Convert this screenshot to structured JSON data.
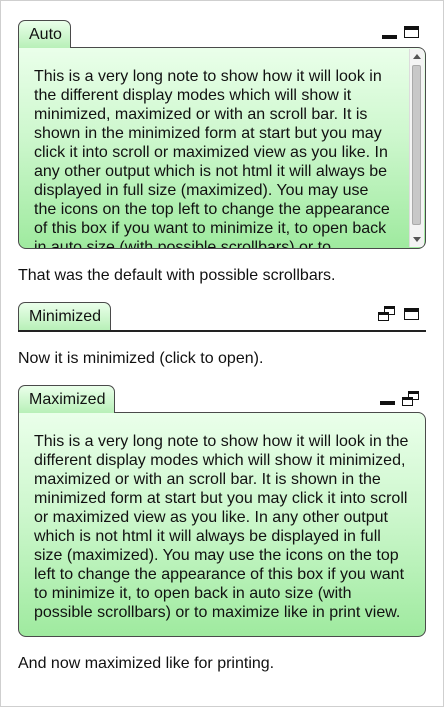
{
  "notes": [
    {
      "title": "Auto",
      "mode": "auto",
      "text": "This is a very long note to show how it will look in the different display modes which will show it minimized, maximized or with an scroll bar. It is shown in the minimized form at start but you may click it into scroll or maximized view as you like. In any other output which is not html it will always be displayed in full size (maximized). You may use the icons on the top left to change the appearance of this box if you want to minimize it, to open back in auto size (with possible scrollbars) or to maximize like in print view.",
      "controls": [
        "minimize-icon",
        "maximize-icon"
      ],
      "caption": "That was the default with possible scrollbars."
    },
    {
      "title": "Minimized",
      "mode": "minimized",
      "controls": [
        "restore-icon",
        "maximize-icon"
      ],
      "caption": "Now it is minimized (click to open)."
    },
    {
      "title": "Maximized",
      "mode": "maximized",
      "text": "This is a very long note to show how it will look in the different display modes which will show it minimized, maximized or with an scroll bar. It is shown in the minimized form at start but you may click it into scroll or maximized view as you like. In any other output which is not html it will always be displayed in full size (maximized). You may use the icons on the top left to change the appearance of this box if you want to minimize it, to open back in auto size (with possible scrollbars) or to maximize like in print view.",
      "controls": [
        "minimize-icon",
        "restore-icon"
      ],
      "caption": "And now maximized like for printing."
    }
  ]
}
